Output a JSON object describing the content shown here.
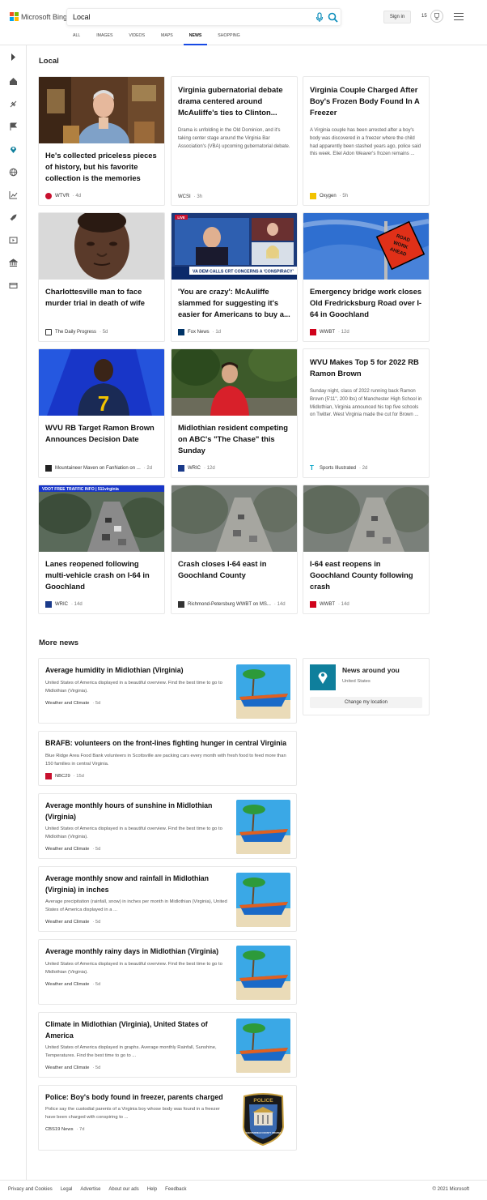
{
  "brand": {
    "name": "Microsoft Bing"
  },
  "search": {
    "value": "Local"
  },
  "header": {
    "signin_label": "Sign in",
    "rewards_count": "15"
  },
  "tabs": [
    {
      "label": "ALL"
    },
    {
      "label": "IMAGES"
    },
    {
      "label": "VIDEOS"
    },
    {
      "label": "MAPS"
    },
    {
      "label": "NEWS",
      "active": true
    },
    {
      "label": "SHOPPING"
    }
  ],
  "rail": [
    {
      "icon": "chevron-right-icon"
    },
    {
      "icon": "home-icon"
    },
    {
      "icon": "sports-icon"
    },
    {
      "icon": "flag-icon"
    },
    {
      "icon": "location-icon"
    },
    {
      "icon": "globe-icon"
    },
    {
      "icon": "chart-icon"
    },
    {
      "icon": "rocket-icon"
    },
    {
      "icon": "video-icon"
    },
    {
      "icon": "bank-icon"
    },
    {
      "icon": "card-icon"
    }
  ],
  "local": {
    "title": "Local",
    "cards": [
      {
        "title": "He's collected priceless pieces of history, but his favorite collection is the memories",
        "source": "WTVR",
        "age": "4d",
        "image": "man-with-collection"
      },
      {
        "title": "Virginia gubernatorial debate drama centered around McAuliffe's ties to Clinton...",
        "snippet": "Drama is unfolding in the Old Dominion, and it's taking center stage around the Virginia Bar Association's (VBA) upcoming gubernatorial debate.",
        "source": "WCSI",
        "age": "3h"
      },
      {
        "title": "Virginia Couple Charged After Boy's Frozen Body Found In A Freezer",
        "snippet": "A Virginia couple has been arrested after a boy's body was discovered in a freezer where the child had apparently been stashed years ago, police said this week. Eliel Adon Weaver's frozen remains ...",
        "source": "Oxygen",
        "age": "5h"
      },
      {
        "title": "Charlottesville man to face murder trial in death of wife",
        "source": "The Daily Progress",
        "age": "5d",
        "image": "man-portrait"
      },
      {
        "title": "'You are crazy': McAuliffe slammed for suggesting it's easier for Americans to buy a...",
        "source": "Fox News",
        "age": "1d",
        "image": "tv-panel",
        "image_caption": "VA DEM CALLS CRT CONCERNS A 'CONSPIRACY'",
        "image_badge": "LIVE"
      },
      {
        "title": "Emergency bridge work closes Old Fredricksburg Road over I-64 in Goochland",
        "source": "WWBT",
        "age": "12d",
        "image": "road-work-sign",
        "sign_text": "ROAD WORK AHEAD"
      },
      {
        "title": "WVU RB Target Ramon Brown Announces Decision Date",
        "source": "Mountaineer Maven on FanNation on ...",
        "age": "2d",
        "image": "football-player"
      },
      {
        "title": "Midlothian resident competing on ABC's \"The Chase\" this Sunday",
        "source": "WRIC",
        "age": "12d",
        "image": "man-red-shirt"
      },
      {
        "title": "WVU Makes Top 5 for 2022 RB Ramon Brown",
        "snippet": "Sunday night, class of 2022 running back Ramon Brown (5'11\", 200 lbs) of Manchester High School in Midlothian, Virginia announced his top five schools on Twitter. West Virginia made the cut for Brown ...",
        "source": "Sports Illustrated",
        "age": "2d"
      },
      {
        "title": "Lanes reopened following multi-vehicle crash on I-64 in Goochland",
        "source": "WRIC",
        "age": "14d",
        "image": "traffic-cam",
        "image_caption": "VDOT   FREE TRAFFIC INFO | 511virginia"
      },
      {
        "title": "Crash closes I-64 east in Goochland County",
        "source": "Richmond-Petersburg WWBT on MS...",
        "age": "14d",
        "image": "traffic-cam-blur"
      },
      {
        "title": "I-64 east reopens in Goochland County following crash",
        "source": "WWBT",
        "age": "14d",
        "image": "traffic-cam-blur"
      }
    ]
  },
  "more_news": {
    "title": "More news",
    "items": [
      {
        "title": "Average humidity in Midlothian (Virginia)",
        "snippet": "United States of America displayed in a beautiful overview. Find the best time to go to Midlothian (Virginia).",
        "source": "Weather and Climate",
        "age": "5d",
        "thumb": "beach-boat"
      },
      {
        "title": "BRAFB: volunteers on the front-lines fighting hunger in central Virginia",
        "snippet": "Blue Ridge Area Food Bank volunteers in Scottsville are packing cars every month with fresh food to feed more than 150 families in central Virginia.",
        "source": "NBC29",
        "age": "15d"
      },
      {
        "title": "Average monthly hours of sunshine in Midlothian (Virginia)",
        "snippet": "United States of America displayed in a beautiful overview. Find the best time to go to Midlothian (Virginia).",
        "source": "Weather and Climate",
        "age": "5d",
        "thumb": "beach-boat"
      },
      {
        "title": "Average monthly snow and rainfall in Midlothian (Virginia) in inches",
        "snippet": "Average precipitation (rainfall, snow) in inches per month in Midlothian (Virginia), United States of America displayed in a ...",
        "source": "Weather and Climate",
        "age": "5d",
        "thumb": "beach-boat"
      },
      {
        "title": "Average monthly rainy days in Midlothian (Virginia)",
        "snippet": "United States of America displayed in a beautiful overview. Find the best time to go to Midlothian (Virginia).",
        "source": "Weather and Climate",
        "age": "5d",
        "thumb": "beach-boat"
      },
      {
        "title": "Climate in Midlothian (Virginia), United States of America",
        "snippet": "United States of America displayed in graphs. Average monthly Rainfall, Sunshine, Temperatures. Find the best time to go to ...",
        "source": "Weather and Climate",
        "age": "5d",
        "thumb": "beach-boat"
      },
      {
        "title": "Police: Boy's body found in freezer, parents charged",
        "snippet": "Police say the custodial parents of a Virginia boy whose body was found in a freezer have been charged with conspiring to ...",
        "source": "CBS19 News",
        "age": "7d",
        "thumb": "police-badge",
        "badge_top": "POLICE",
        "badge_bottom": "CHESTERFIELD COUNTY VIRGINIA"
      }
    ]
  },
  "news_around_you": {
    "title": "News around you",
    "subtitle": "United States",
    "button": "Change my location"
  },
  "footer": {
    "links": [
      "Privacy and Cookies",
      "Legal",
      "Advertise",
      "About our ads",
      "Help",
      "Feedback"
    ],
    "copyright": "© 2021 Microsoft"
  }
}
